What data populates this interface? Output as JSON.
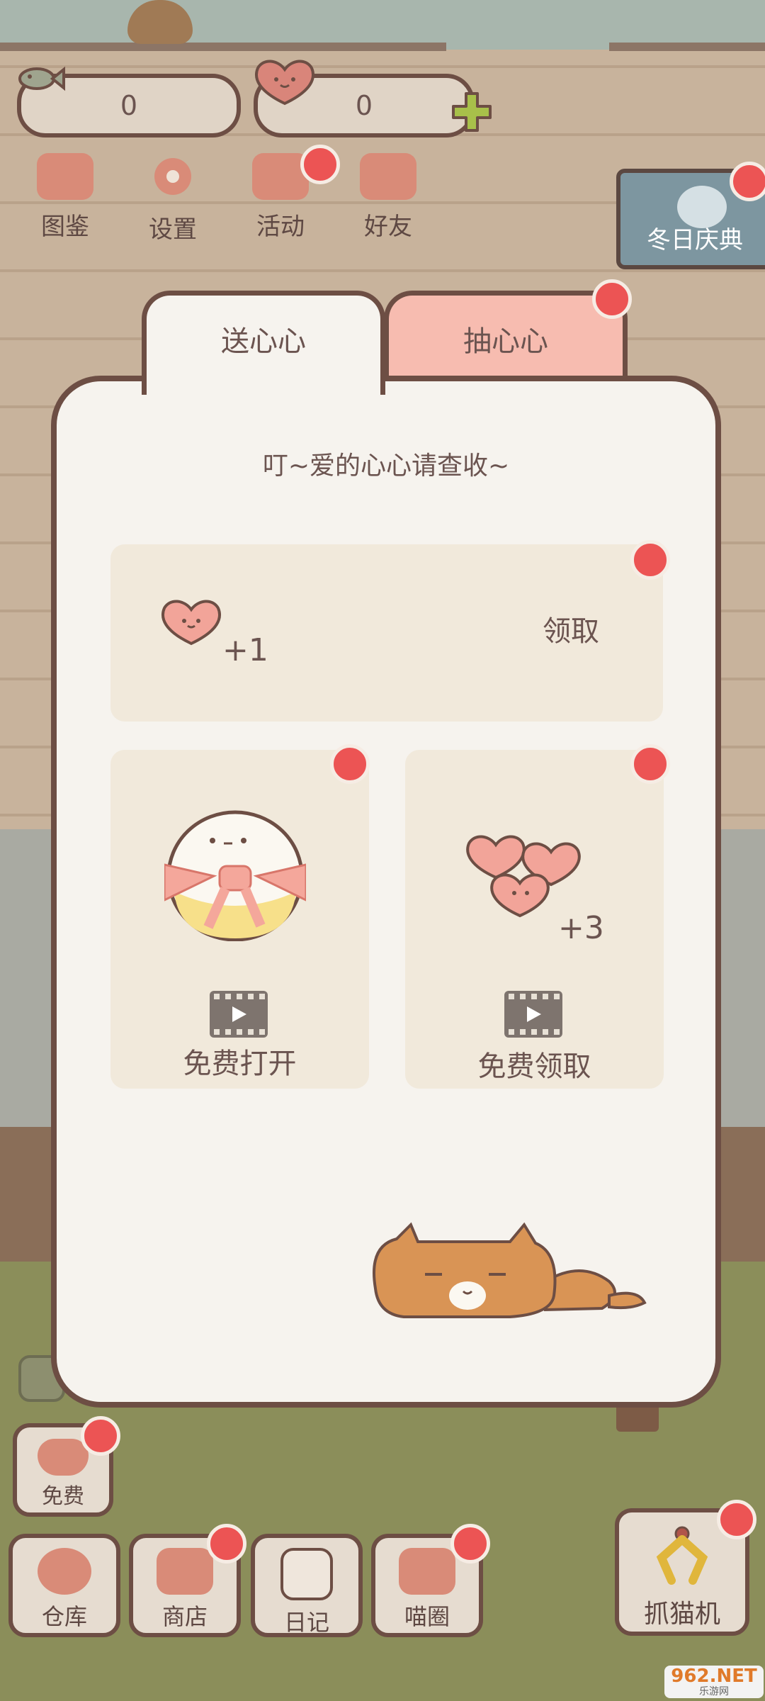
{
  "currency": {
    "fish_count": "0",
    "heart_count": "0"
  },
  "top_menu": {
    "items": [
      {
        "label": "图鉴",
        "icon": "cat-head-icon"
      },
      {
        "label": "设置",
        "icon": "gear-icon"
      },
      {
        "label": "活动",
        "icon": "gift-icon"
      },
      {
        "label": "好友",
        "icon": "friends-icon"
      }
    ]
  },
  "event_button": {
    "label": "冬日庆典"
  },
  "tabs": [
    {
      "label": "送心心",
      "active": true
    },
    {
      "label": "抽心心",
      "active": false
    }
  ],
  "panel": {
    "title": "叮~爱的心心请查收~",
    "claim_card": {
      "amount": "+1",
      "action": "领取"
    },
    "gift_card": {
      "action": "免费打开"
    },
    "hearts_card": {
      "amount": "+3",
      "action": "免费领取"
    }
  },
  "bottom": {
    "free_button": {
      "label": "免费"
    },
    "nav": [
      {
        "label": "仓库"
      },
      {
        "label": "商店"
      },
      {
        "label": "日记"
      },
      {
        "label": "喵圈"
      }
    ],
    "claw_machine": {
      "label": "抓猫机"
    }
  },
  "watermark": {
    "main": "962.NET",
    "sub": "乐游网"
  },
  "colors": {
    "accent_red": "#ec5454",
    "heart_pink": "#f2a499",
    "panel_bg": "#f6f3ee",
    "card_bg": "#f1e9db",
    "tab_inactive": "#f7bcb0",
    "event_blue": "#7d96a0",
    "outline_brown": "#6d4e44"
  }
}
